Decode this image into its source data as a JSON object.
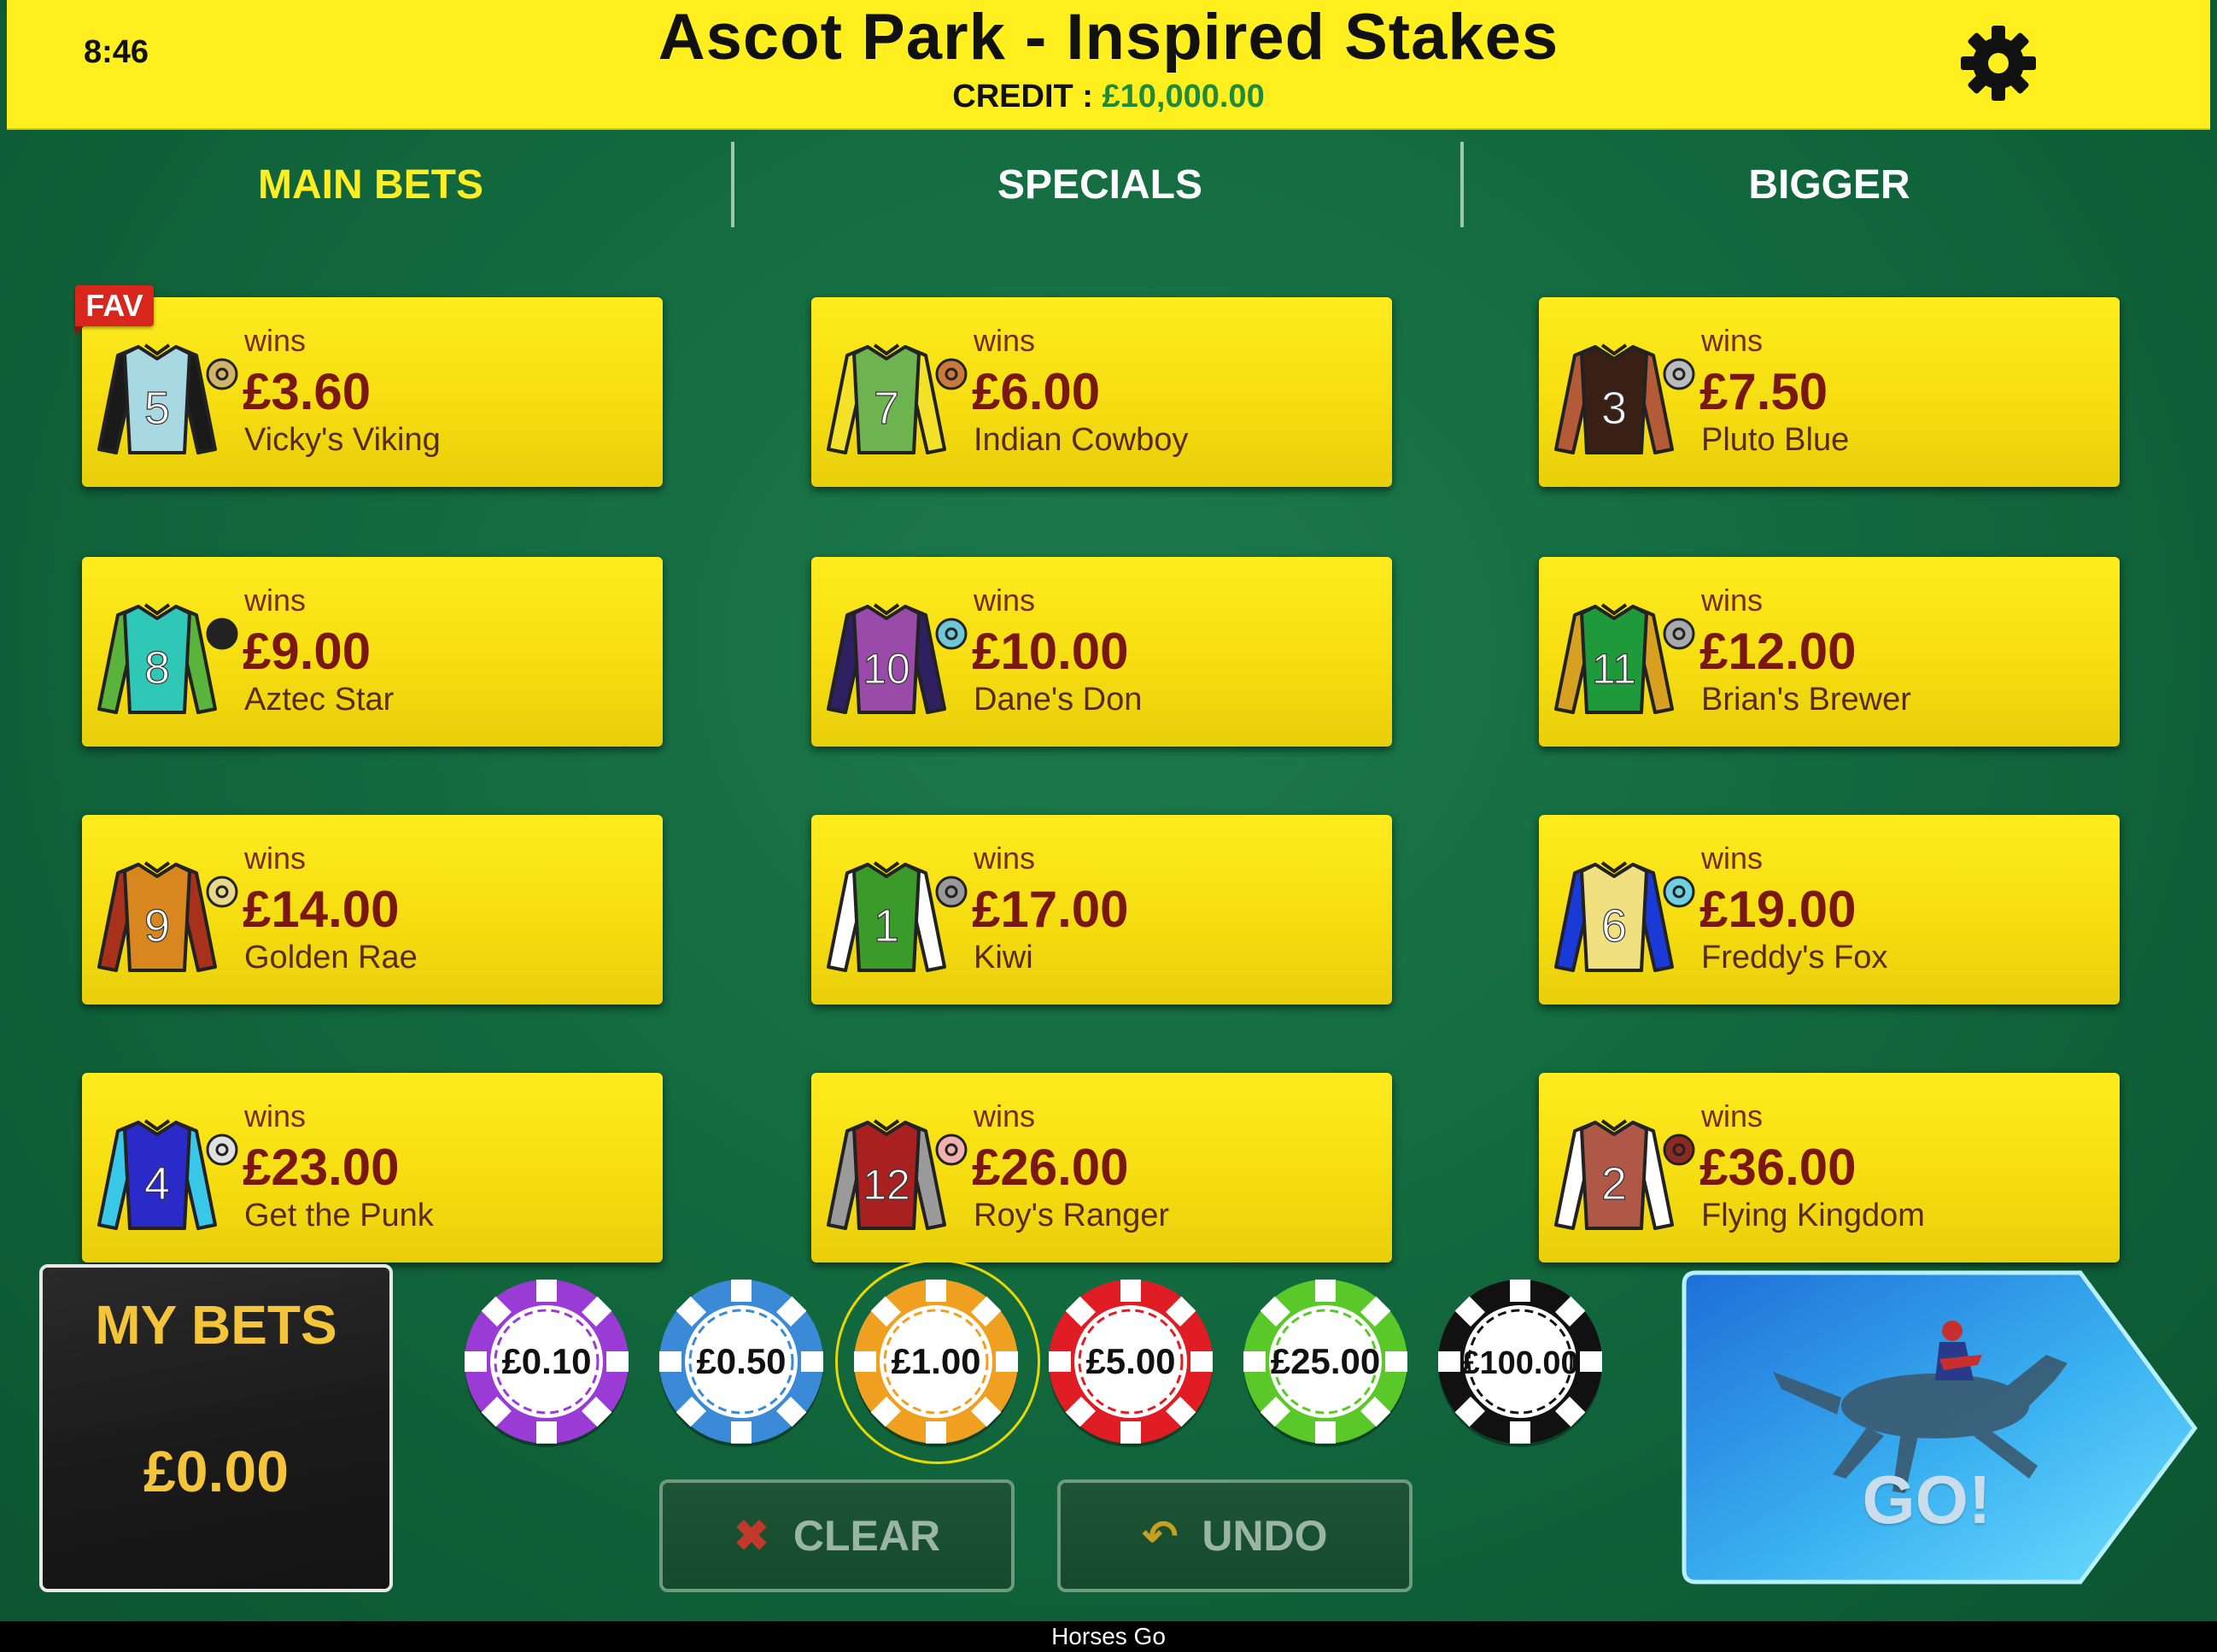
{
  "header": {
    "clock": "8:46",
    "title": "Ascot Park - Inspired Stakes",
    "credit_label": "CREDIT :",
    "credit_value": "£10,000.00"
  },
  "tabs": [
    {
      "label": "MAIN BETS",
      "active": true
    },
    {
      "label": "SPECIALS",
      "active": false
    },
    {
      "label": "BIGGER",
      "active": false
    }
  ],
  "fav_badge": "FAV",
  "bets": [
    {
      "number": "5",
      "wins": "wins",
      "price": "£3.60",
      "name": "Vicky's Viking",
      "body": "#a8d8e2",
      "sleeve": "#1a1a1a",
      "num_color": "#ffffff",
      "cap": "#d2b36a"
    },
    {
      "number": "7",
      "wins": "wins",
      "price": "£6.00",
      "name": "Indian Cowboy",
      "body": "#6db34f",
      "sleeve": "#f3e12a",
      "num_color": "#ffffff",
      "cap": "#c97a3a"
    },
    {
      "number": "3",
      "wins": "wins",
      "price": "£7.50",
      "name": "Pluto Blue",
      "body": "#3a1f14",
      "sleeve": "#b35a37",
      "num_color": "#ffffff",
      "cap": "#bbbbbb"
    },
    {
      "number": "8",
      "wins": "wins",
      "price": "£9.00",
      "name": "Aztec Star",
      "body": "#2fc7b5",
      "sleeve": "#5ab33b",
      "num_color": "#ffffff",
      "cap": "#222222"
    },
    {
      "number": "10",
      "wins": "wins",
      "price": "£10.00",
      "name": "Dane's Don",
      "body": "#9a4aa8",
      "sleeve": "#2e2060",
      "num_color": "#ffffff",
      "cap": "#6fc7d6"
    },
    {
      "number": "11",
      "wins": "wins",
      "price": "£12.00",
      "name": "Brian's Brewer",
      "body": "#1e9a3a",
      "sleeve": "#d8a020",
      "num_color": "#ffffff",
      "cap": "#aaaaaa"
    },
    {
      "number": "9",
      "wins": "wins",
      "price": "£14.00",
      "name": "Golden Rae",
      "body": "#d8861e",
      "sleeve": "#a8311c",
      "num_color": "#ffffff",
      "cap": "#e8d88a"
    },
    {
      "number": "1",
      "wins": "wins",
      "price": "£17.00",
      "name": "Kiwi",
      "body": "#3a9a2a",
      "sleeve": "#ffffff",
      "num_color": "#ffffff",
      "cap": "#999999"
    },
    {
      "number": "6",
      "wins": "wins",
      "price": "£19.00",
      "name": "Freddy's Fox",
      "body": "#f0e080",
      "sleeve": "#1a3ad8",
      "num_color": "#ffffff",
      "cap": "#6fd0e0"
    },
    {
      "number": "4",
      "wins": "wins",
      "price": "£23.00",
      "name": "Get the Punk",
      "body": "#2a2ac8",
      "sleeve": "#3ac8e8",
      "num_color": "#ffffff",
      "cap": "#e0e0e0"
    },
    {
      "number": "12",
      "wins": "wins",
      "price": "£26.00",
      "name": "Roy's Ranger",
      "body": "#a82020",
      "sleeve": "#9a9a9a",
      "num_color": "#ffffff",
      "cap": "#f0b0b0"
    },
    {
      "number": "2",
      "wins": "wins",
      "price": "£36.00",
      "name": "Flying Kingdom",
      "body": "#b05848",
      "sleeve": "#ffffff",
      "num_color": "#ffffff",
      "cap": "#8a2a20"
    }
  ],
  "my_bets": {
    "label": "MY BETS",
    "value": "£0.00"
  },
  "chips": [
    {
      "label": "£0.10",
      "color": "#9b3bd6",
      "selected": false
    },
    {
      "label": "£0.50",
      "color": "#3a8ad8",
      "selected": false
    },
    {
      "label": "£1.00",
      "color": "#f0a020",
      "selected": true
    },
    {
      "label": "£5.00",
      "color": "#e01c24",
      "selected": false
    },
    {
      "label": "£25.00",
      "color": "#5ac828",
      "selected": false
    },
    {
      "label": "£100.00",
      "color": "#111111",
      "selected": false
    }
  ],
  "controls": {
    "clear": "CLEAR",
    "undo": "UNDO",
    "go": "GO!"
  },
  "footer": "Horses Go",
  "colors": {
    "header_bg": "#ffef1f",
    "active_tab": "#ffee22",
    "price": "#7a1810",
    "credit": "#1f8a3a"
  }
}
